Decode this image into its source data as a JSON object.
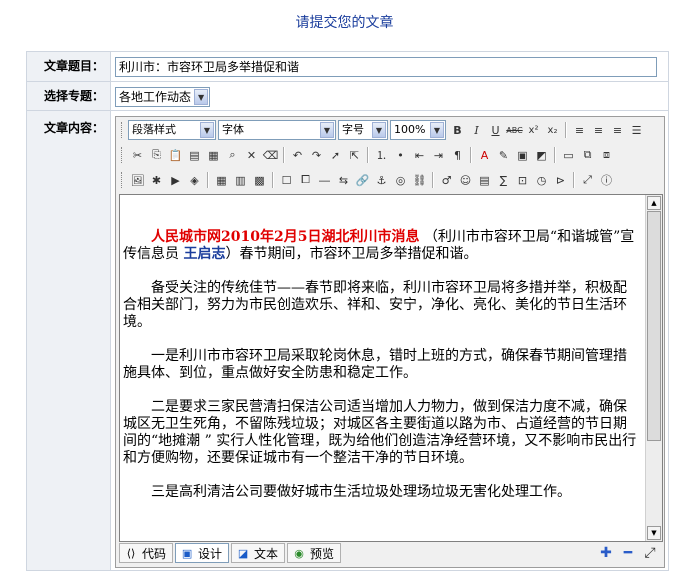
{
  "page": {
    "title": "请提交您的文章"
  },
  "form": {
    "title_label": "文章题目：",
    "title_value": "利川市：市容环卫局多举措促和谐",
    "category_label": "选择专题：",
    "category_value": "各地工作动态",
    "content_label": "文章内容："
  },
  "toolbar": {
    "paragraph_style": "段落样式",
    "font": "字体",
    "font_size": "字号",
    "zoom": "100%"
  },
  "content": {
    "headline": "人民城市网2010年2月5日湖北利川市消息",
    "intro": "（利川市市容环卫局“和谐城管”宣传信息员",
    "author": "王启志",
    "intro_end": "）春节期间，市容环卫局多举措促和谐。",
    "p1": "备受关注的传统佳节——春节即将来临，利川市容环卫局将多措并举，积极配合相关部门，努力为市民创造欢乐、祥和、安宁，净化、亮化、美化的节日生活环境。",
    "p2": "一是利川市市容环卫局采取轮岗休息，错时上班的方式，确保春节期间管理措施具体、到位，重点做好安全防患和稳定工作。",
    "p3": "二是要求三家民营清扫保洁公司适当增加人力物力，做到保洁力度不减，确保城区无卫生死角，不留陈残垃圾；对城区各主要街道以路为市、占道经营的节日期间的“地摊潮 ” 实行人性化管理，既为给他们创造洁净经营环境，又不影响市民出行和方便购物，还要保证城市有一个整洁干净的节日环境。",
    "p4": "三是高利清洁公司要做好城市生活垃圾处理场垃圾无害化处理工作。"
  },
  "modes": {
    "code": "代码",
    "design": "设计",
    "text": "文本",
    "preview": "预览"
  }
}
